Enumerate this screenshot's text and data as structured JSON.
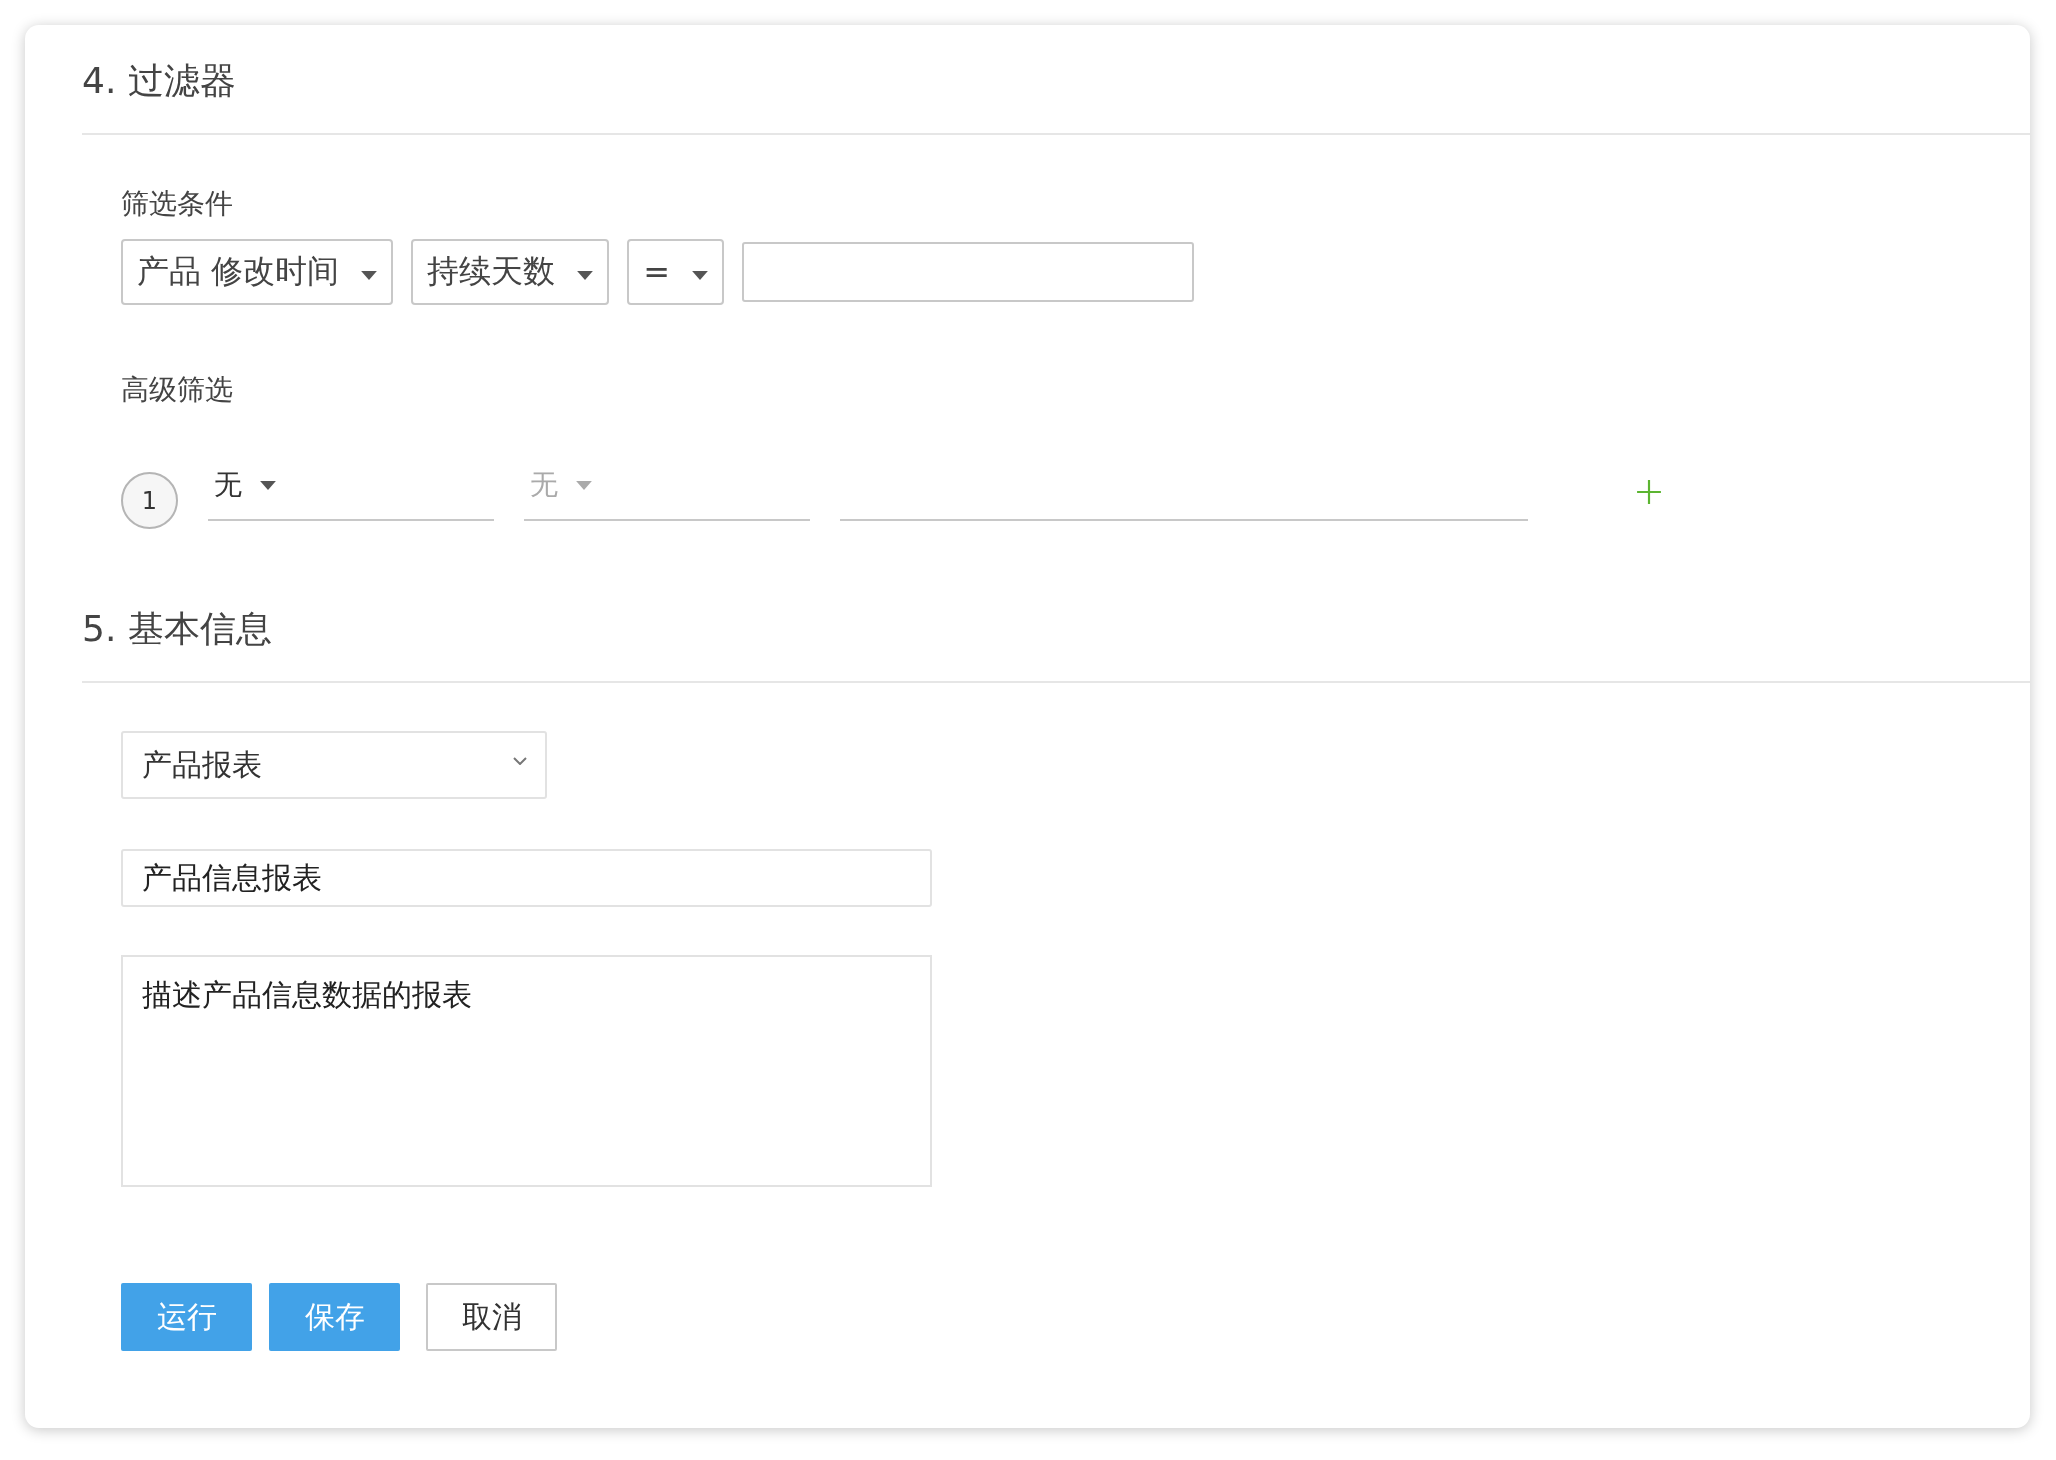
{
  "filter_section": {
    "title": "4. 过滤器",
    "conditions_label": "筛选条件",
    "conditions": [
      {
        "value": "产品 修改时间"
      },
      {
        "value": "持续天数"
      },
      {
        "value": "="
      }
    ],
    "advanced_label": "高级筛选",
    "advanced_rows": [
      {
        "index": "1",
        "dropdowns": [
          {
            "value": "无",
            "disabled": false
          },
          {
            "value": "无",
            "disabled": true
          }
        ]
      }
    ]
  },
  "info_section": {
    "title": "5. 基本信息",
    "category_select": {
      "value": "产品报表"
    },
    "name_input": {
      "value": "产品信息报表"
    },
    "description": {
      "value": "描述产品信息数据的报表"
    }
  },
  "buttons": [
    {
      "label": "运行",
      "kind": "primary"
    },
    {
      "label": "保存",
      "kind": "primary"
    },
    {
      "label": "取消",
      "kind": "secondary"
    }
  ]
}
